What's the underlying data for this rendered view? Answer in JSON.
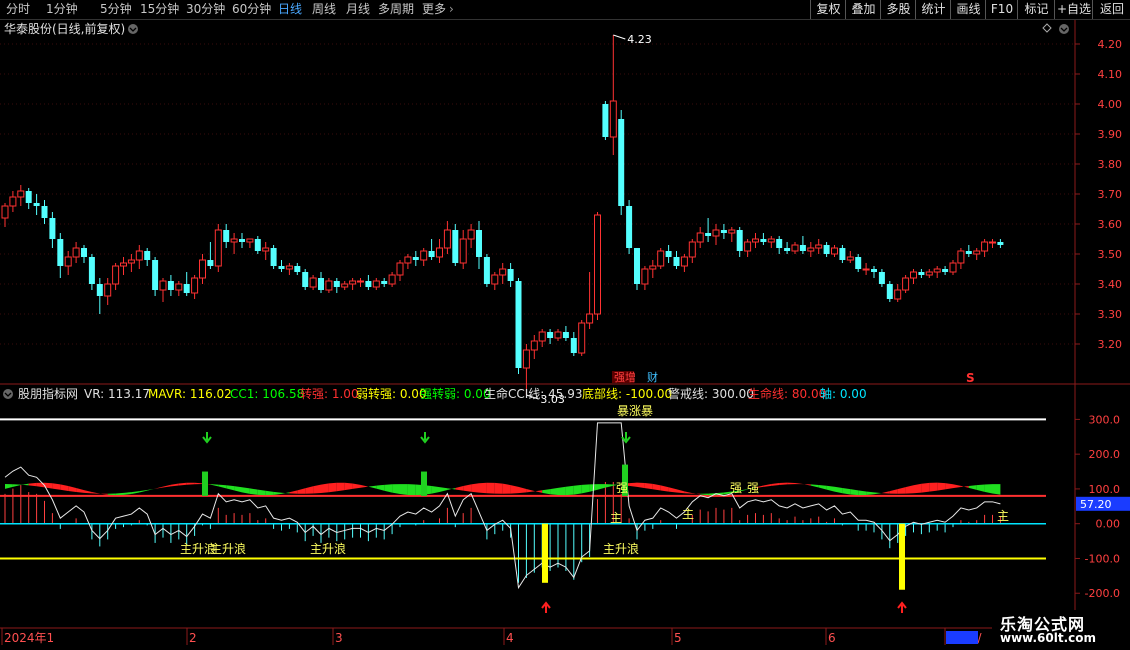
{
  "toolbar": {
    "periods": [
      "分时",
      "1分钟",
      "5分钟",
      "15分钟",
      "30分钟",
      "60分钟",
      "日线",
      "周线",
      "月线",
      "多周期",
      "更多"
    ],
    "active_period": "日线",
    "more_chevron": "›",
    "right_buttons": [
      "复权",
      "叠加",
      "多股",
      "统计",
      "画线",
      "F10",
      "+自选",
      "返回"
    ],
    "right_button_labels": [
      "复权",
      "叠加",
      "多股",
      "统计",
      "画线",
      "F10",
      "标记",
      "+自选",
      "返回"
    ]
  },
  "stock": {
    "title": "华泰股份(日线,前复权)"
  },
  "main": {
    "y_ticks": [
      "4.20",
      "4.10",
      "4.00",
      "3.90",
      "3.80",
      "3.70",
      "3.60",
      "3.50",
      "3.40",
      "3.30",
      "3.20"
    ],
    "high_label": "4.23",
    "low_label": "3.03",
    "event_markers": [
      "强增",
      "财"
    ],
    "s_marker": "S"
  },
  "indicator": {
    "name": "股朋指标网",
    "values": [
      {
        "text": "VR: 113.17",
        "color": "#e0e0e0"
      },
      {
        "text": "MAVR: 116.02",
        "color": "#ffff00"
      },
      {
        "text": "CC1: 106.58",
        "color": "#00ff00"
      },
      {
        "text": "转强: 1.00",
        "color": "#ff3030"
      },
      {
        "text": "弱转强: 0.00",
        "color": "#ffff00"
      },
      {
        "text": "强转弱: 0.00",
        "color": "#00ff00"
      },
      {
        "text": "生命CCI线: 45.93",
        "color": "#e0e0e0"
      },
      {
        "text": "底部线: -100.00",
        "color": "#ffff00"
      },
      {
        "text": "警戒线: 300.00",
        "color": "#e0e0e0"
      },
      {
        "text": "生命线: 80.00",
        "color": "#ff3030"
      },
      {
        "text": "轴: 0.00",
        "color": "#00e5ff"
      }
    ],
    "y_ticks": [
      "300.0",
      "200.0",
      "100.0",
      "0.00",
      "-100.0",
      "-200.0"
    ],
    "current_value": "57.20",
    "annotations": [
      "主升浪",
      "主升浪",
      "主升浪",
      "主升浪",
      "暴涨暴",
      "强",
      "强",
      "强",
      "主",
      "主",
      "主"
    ]
  },
  "x_axis": {
    "labels": [
      "2024年1",
      "2",
      "3",
      "4",
      "5",
      "6",
      "2025/"
    ]
  },
  "watermark": {
    "title": "乐淘公式网",
    "url": "www.60lt.com"
  },
  "colors": {
    "up": "#ff3232",
    "down": "#54ffff",
    "accent": "#4aa8ff",
    "background": "#000000"
  },
  "chart_data": {
    "type": "candlestick",
    "note_source": "values read from price axis",
    "candles": [
      [
        3.62,
        3.67,
        3.59,
        3.66
      ],
      [
        3.66,
        3.71,
        3.64,
        3.69
      ],
      [
        3.69,
        3.73,
        3.66,
        3.71
      ],
      [
        3.71,
        3.72,
        3.65,
        3.67
      ],
      [
        3.67,
        3.7,
        3.63,
        3.66
      ],
      [
        3.66,
        3.68,
        3.6,
        3.62
      ],
      [
        3.62,
        3.64,
        3.52,
        3.55
      ],
      [
        3.55,
        3.57,
        3.42,
        3.46
      ],
      [
        3.46,
        3.51,
        3.43,
        3.49
      ],
      [
        3.49,
        3.54,
        3.47,
        3.52
      ],
      [
        3.52,
        3.53,
        3.47,
        3.49
      ],
      [
        3.49,
        3.5,
        3.38,
        3.4
      ],
      [
        3.4,
        3.42,
        3.3,
        3.36
      ],
      [
        3.36,
        3.42,
        3.33,
        3.4
      ],
      [
        3.4,
        3.47,
        3.38,
        3.46
      ],
      [
        3.46,
        3.49,
        3.43,
        3.47
      ],
      [
        3.47,
        3.5,
        3.44,
        3.48
      ],
      [
        3.48,
        3.53,
        3.45,
        3.51
      ],
      [
        3.51,
        3.52,
        3.46,
        3.48
      ],
      [
        3.48,
        3.49,
        3.36,
        3.38
      ],
      [
        3.38,
        3.42,
        3.34,
        3.41
      ],
      [
        3.41,
        3.43,
        3.36,
        3.38
      ],
      [
        3.38,
        3.41,
        3.36,
        3.4
      ],
      [
        3.4,
        3.44,
        3.36,
        3.37
      ],
      [
        3.37,
        3.43,
        3.35,
        3.42
      ],
      [
        3.42,
        3.5,
        3.4,
        3.48
      ],
      [
        3.48,
        3.54,
        3.45,
        3.46
      ],
      [
        3.46,
        3.6,
        3.44,
        3.58
      ],
      [
        3.58,
        3.6,
        3.52,
        3.54
      ],
      [
        3.54,
        3.57,
        3.5,
        3.55
      ],
      [
        3.55,
        3.57,
        3.52,
        3.54
      ],
      [
        3.54,
        3.55,
        3.52,
        3.55
      ],
      [
        3.55,
        3.56,
        3.5,
        3.51
      ],
      [
        3.51,
        3.54,
        3.48,
        3.52
      ],
      [
        3.52,
        3.53,
        3.45,
        3.46
      ],
      [
        3.46,
        3.48,
        3.44,
        3.45
      ],
      [
        3.45,
        3.47,
        3.43,
        3.46
      ],
      [
        3.46,
        3.47,
        3.43,
        3.44
      ],
      [
        3.44,
        3.45,
        3.38,
        3.39
      ],
      [
        3.39,
        3.43,
        3.38,
        3.42
      ],
      [
        3.42,
        3.44,
        3.37,
        3.38
      ],
      [
        3.38,
        3.42,
        3.37,
        3.41
      ],
      [
        3.41,
        3.42,
        3.37,
        3.39
      ],
      [
        3.39,
        3.41,
        3.38,
        3.4
      ],
      [
        3.4,
        3.42,
        3.38,
        3.41
      ],
      [
        3.41,
        3.42,
        3.39,
        3.41
      ],
      [
        3.41,
        3.43,
        3.38,
        3.39
      ],
      [
        3.39,
        3.42,
        3.38,
        3.41
      ],
      [
        3.41,
        3.42,
        3.39,
        3.4
      ],
      [
        3.4,
        3.44,
        3.39,
        3.43
      ],
      [
        3.43,
        3.48,
        3.41,
        3.47
      ],
      [
        3.47,
        3.5,
        3.45,
        3.49
      ],
      [
        3.49,
        3.51,
        3.46,
        3.48
      ],
      [
        3.48,
        3.52,
        3.46,
        3.51
      ],
      [
        3.51,
        3.55,
        3.48,
        3.49
      ],
      [
        3.49,
        3.55,
        3.47,
        3.52
      ],
      [
        3.52,
        3.61,
        3.5,
        3.58
      ],
      [
        3.58,
        3.6,
        3.46,
        3.47
      ],
      [
        3.47,
        3.58,
        3.45,
        3.55
      ],
      [
        3.55,
        3.6,
        3.52,
        3.58
      ],
      [
        3.58,
        3.61,
        3.45,
        3.49
      ],
      [
        3.49,
        3.5,
        3.39,
        3.4
      ],
      [
        3.4,
        3.44,
        3.38,
        3.43
      ],
      [
        3.43,
        3.47,
        3.4,
        3.45
      ],
      [
        3.45,
        3.47,
        3.39,
        3.41
      ],
      [
        3.41,
        3.42,
        3.1,
        3.12
      ],
      [
        3.12,
        3.2,
        3.03,
        3.18
      ],
      [
        3.18,
        3.23,
        3.15,
        3.21
      ],
      [
        3.21,
        3.25,
        3.19,
        3.24
      ],
      [
        3.24,
        3.25,
        3.2,
        3.22
      ],
      [
        3.22,
        3.25,
        3.21,
        3.24
      ],
      [
        3.24,
        3.26,
        3.21,
        3.22
      ],
      [
        3.22,
        3.24,
        3.16,
        3.17
      ],
      [
        3.17,
        3.28,
        3.16,
        3.27
      ],
      [
        3.27,
        3.44,
        3.25,
        3.3
      ],
      [
        3.3,
        3.64,
        3.28,
        3.63
      ],
      [
        4.0,
        4.01,
        3.88,
        3.89
      ],
      [
        3.89,
        4.23,
        3.83,
        4.01
      ],
      [
        3.95,
        3.98,
        3.63,
        3.66
      ],
      [
        3.66,
        3.68,
        3.5,
        3.52
      ],
      [
        3.52,
        3.52,
        3.38,
        3.4
      ],
      [
        3.4,
        3.46,
        3.38,
        3.45
      ],
      [
        3.45,
        3.48,
        3.42,
        3.46
      ],
      [
        3.46,
        3.52,
        3.45,
        3.51
      ],
      [
        3.51,
        3.53,
        3.47,
        3.49
      ],
      [
        3.49,
        3.51,
        3.45,
        3.46
      ],
      [
        3.46,
        3.5,
        3.44,
        3.49
      ],
      [
        3.49,
        3.55,
        3.47,
        3.54
      ],
      [
        3.54,
        3.59,
        3.52,
        3.57
      ],
      [
        3.57,
        3.62,
        3.54,
        3.56
      ],
      [
        3.56,
        3.6,
        3.53,
        3.58
      ],
      [
        3.58,
        3.6,
        3.55,
        3.57
      ],
      [
        3.57,
        3.59,
        3.54,
        3.58
      ],
      [
        3.58,
        3.59,
        3.49,
        3.51
      ],
      [
        3.51,
        3.55,
        3.49,
        3.54
      ],
      [
        3.54,
        3.57,
        3.52,
        3.55
      ],
      [
        3.55,
        3.57,
        3.53,
        3.54
      ],
      [
        3.54,
        3.56,
        3.52,
        3.55
      ],
      [
        3.55,
        3.56,
        3.5,
        3.52
      ],
      [
        3.52,
        3.54,
        3.5,
        3.51
      ],
      [
        3.51,
        3.54,
        3.5,
        3.53
      ],
      [
        3.53,
        3.56,
        3.5,
        3.51
      ],
      [
        3.51,
        3.54,
        3.49,
        3.52
      ],
      [
        3.52,
        3.55,
        3.5,
        3.53
      ],
      [
        3.53,
        3.54,
        3.49,
        3.5
      ],
      [
        3.5,
        3.53,
        3.49,
        3.52
      ],
      [
        3.52,
        3.53,
        3.47,
        3.48
      ],
      [
        3.48,
        3.51,
        3.47,
        3.49
      ],
      [
        3.49,
        3.5,
        3.44,
        3.45
      ],
      [
        3.45,
        3.47,
        3.43,
        3.45
      ],
      [
        3.45,
        3.46,
        3.42,
        3.44
      ],
      [
        3.44,
        3.45,
        3.39,
        3.4
      ],
      [
        3.4,
        3.41,
        3.34,
        3.35
      ],
      [
        3.35,
        3.4,
        3.34,
        3.38
      ],
      [
        3.38,
        3.43,
        3.37,
        3.42
      ],
      [
        3.42,
        3.45,
        3.4,
        3.44
      ],
      [
        3.44,
        3.45,
        3.42,
        3.43
      ],
      [
        3.43,
        3.45,
        3.42,
        3.44
      ],
      [
        3.44,
        3.46,
        3.42,
        3.45
      ],
      [
        3.45,
        3.46,
        3.43,
        3.44
      ],
      [
        3.44,
        3.48,
        3.43,
        3.47
      ],
      [
        3.47,
        3.52,
        3.45,
        3.51
      ],
      [
        3.51,
        3.53,
        3.49,
        3.5
      ],
      [
        3.5,
        3.52,
        3.48,
        3.51
      ],
      [
        3.51,
        3.55,
        3.49,
        3.54
      ],
      [
        3.54,
        3.55,
        3.52,
        3.54
      ],
      [
        3.54,
        3.55,
        3.52,
        3.53
      ]
    ],
    "ylim": [
      3.08,
      4.28
    ],
    "indicator_ylim": [
      -300,
      350
    ]
  }
}
